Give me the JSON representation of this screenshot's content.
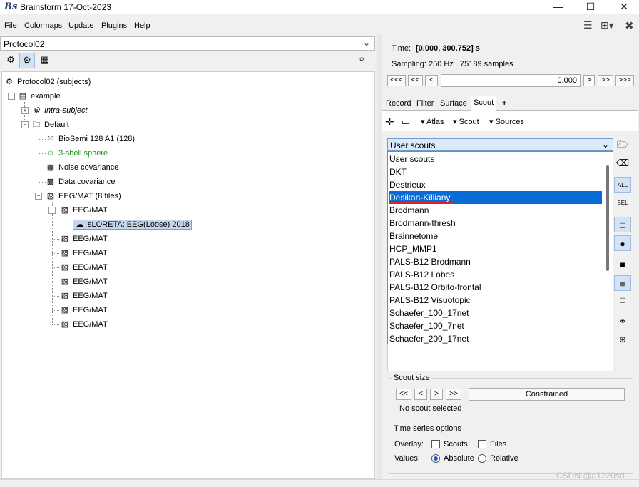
{
  "window": {
    "logo": "Bs",
    "title": "Brainstorm 17-Oct-2023",
    "minimize": "—",
    "maximize": "☐",
    "close": "✕"
  },
  "menu": {
    "items": [
      "File",
      "Colormaps",
      "Update",
      "Plugins",
      "Help"
    ]
  },
  "toolbar_right": {
    "icons": [
      "list-icon",
      "layout-icon",
      "close-tools-icon"
    ],
    "glyphs": [
      "☰",
      "⊞▾",
      "✖"
    ]
  },
  "left": {
    "protocol": "Protocol02",
    "view_modes": [
      "functional-view-icon",
      "subjects-view-icon",
      "studies-view-icon"
    ],
    "tree": {
      "root": "Protocol02 (subjects)",
      "subject": "example",
      "intra": "Intra-subject",
      "default": "Default",
      "channel": "BioSemi 128 A1 (128)",
      "headmodel": "3-shell sphere",
      "noise": "Noise covariance",
      "data_cov": "Data covariance",
      "eegmat_group": "EEG/MAT (8 files)",
      "eeg_items": [
        "EEG/MAT",
        "EEG/MAT",
        "EEG/MAT",
        "EEG/MAT",
        "EEG/MAT",
        "EEG/MAT",
        "EEG/MAT",
        "EEG/MAT"
      ],
      "source": "sLORETA: EEG(Loose) 2018"
    }
  },
  "right": {
    "time_label": "Time:",
    "time_value": "[0.000, 300.752] s",
    "sampling": "Sampling: 250 Hz",
    "samples": "75189 samples",
    "nav_left": [
      "<<<",
      "<<",
      "<"
    ],
    "nav_right": [
      ">",
      ">>",
      ">>>"
    ],
    "time_field": "0.000",
    "tabs": [
      "Record",
      "Filter",
      "Surface",
      "Scout",
      "+"
    ],
    "active_tab": "Scout",
    "scout_toolbar": {
      "atlas": "Atlas",
      "scout": "Scout",
      "sources": "Sources"
    },
    "atlas_selected": "User scouts",
    "atlas_options": [
      "User scouts",
      "DKT",
      "Destrieux",
      "Desikan-Killiany",
      "Brodmann",
      "Brodmann-thresh",
      "Brainnetome",
      "HCP_MMP1",
      "PALS-B12 Brodmann",
      "PALS-B12 Lobes",
      "PALS-B12 Orbito-frontal",
      "PALS-B12 Visuotopic",
      "Schaefer_100_17net",
      "Schaefer_100_7net",
      "Schaefer_200_17net"
    ],
    "highlighted_option": "Desikan-Killiany",
    "side_buttons": [
      "ALL",
      "SEL"
    ],
    "scout_size": {
      "title": "Scout size",
      "buttons": [
        "<<",
        "<",
        ">",
        ">>"
      ],
      "constrained": "Constrained",
      "status": "No scout selected"
    },
    "ts_options": {
      "title": "Time series options",
      "overlay_label": "Overlay:",
      "scouts": "Scouts",
      "files": "Files",
      "values_label": "Values:",
      "absolute": "Absolute",
      "relative": "Relative",
      "selected_value": "Absolute"
    }
  },
  "watermark": "CSDN @a1220sd"
}
